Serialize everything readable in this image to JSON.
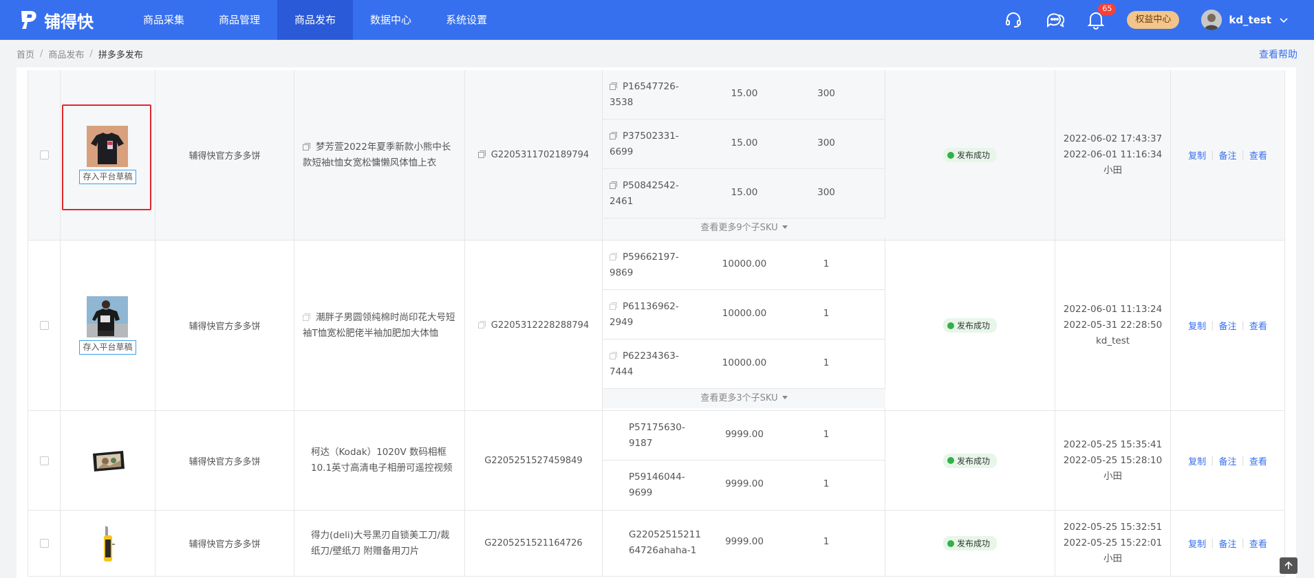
{
  "app": {
    "name": "铺得快"
  },
  "nav": [
    "商品采集",
    "商品管理",
    "商品发布",
    "数据中心",
    "系统设置"
  ],
  "header": {
    "bell_count": "65",
    "rights_label": "权益中心",
    "user_name": "kd_test"
  },
  "breadcrumb": [
    "首页",
    "商品发布",
    "拼多多发布"
  ],
  "help_label": "查看帮助",
  "draft_label": "存入平台草稿",
  "status_label": "发布成功",
  "ops": [
    "复制",
    "备注",
    "查看"
  ],
  "colors": {
    "primary": "#3670ef",
    "header_active": "#2a5ad7",
    "badge": "#f5413a",
    "success": "#32b04a",
    "highlight_border": "#e0262c"
  },
  "rows": [
    {
      "shop": "辅得快官方多多饼",
      "title": "梦芳萱2022年夏季新款小熊中长款短袖t恤女宽松慵懒风体恤上衣",
      "goods_id": "G2205311702189794",
      "skus": [
        {
          "code": "P16547726-3538",
          "price": "15.00",
          "stock": "300"
        },
        {
          "code": "P37502331-6699",
          "price": "15.00",
          "stock": "300"
        },
        {
          "code": "P50842542-2461",
          "price": "15.00",
          "stock": "300"
        }
      ],
      "more_sku": "查看更多9个子SKU",
      "date1": "2022-06-02 17:43:37",
      "date2": "2022-06-01 11:16:34",
      "operator": "小田"
    },
    {
      "shop": "辅得快官方多多饼",
      "title": "潮胖子男圆领纯棉时尚印花大号短袖T恤宽松肥佬半袖加肥加大体恤",
      "goods_id": "G2205312228288794",
      "skus": [
        {
          "code": "P59662197-9869",
          "price": "10000.00",
          "stock": "1"
        },
        {
          "code": "P61136962-2949",
          "price": "10000.00",
          "stock": "1"
        },
        {
          "code": "P62234363-7444",
          "price": "10000.00",
          "stock": "1"
        }
      ],
      "more_sku": "查看更多3个子SKU",
      "date1": "2022-06-01 11:13:24",
      "date2": "2022-05-31 22:28:50",
      "operator": "kd_test"
    },
    {
      "shop": "辅得快官方多多饼",
      "title": "柯达（Kodak）1020V 数码相框10.1英寸高清电子相册可遥控视频",
      "goods_id": "G2205251527459849",
      "skus": [
        {
          "code": "P57175630-9187",
          "price": "9999.00",
          "stock": "1"
        },
        {
          "code": "P59146044-9699",
          "price": "9999.00",
          "stock": "1"
        }
      ],
      "date1": "2022-05-25 15:35:41",
      "date2": "2022-05-25 15:28:10",
      "operator": "小田"
    },
    {
      "shop": "辅得快官方多多饼",
      "title": "得力(deli)大号黑刃自锁美工刀/裁纸刀/壁纸刀 附赠备用刀片",
      "goods_id": "G2205251521164726",
      "skus": [
        {
          "code": "G2205251521164726ahaha-1",
          "price": "9999.00",
          "stock": "1"
        }
      ],
      "date1": "2022-05-25 15:32:51",
      "date2": "2022-05-25 15:22:01",
      "operator": "小田"
    }
  ]
}
